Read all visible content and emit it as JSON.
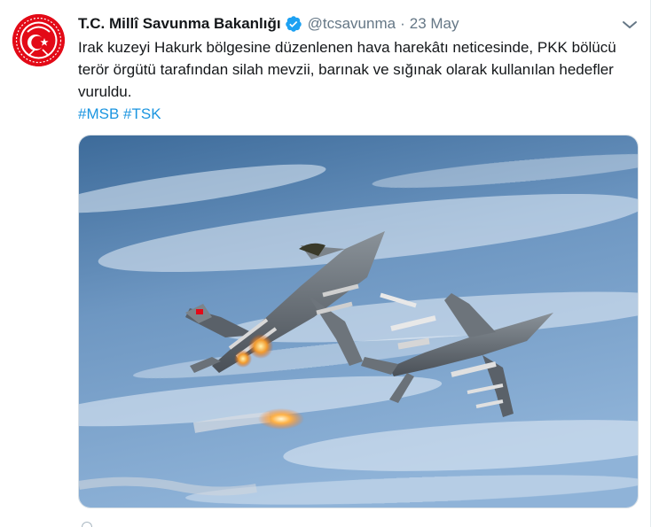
{
  "tweet": {
    "author_name": "T.C. Millî Savunma Bakanlığı",
    "author_handle": "@tcsavunma",
    "separator": "·",
    "timestamp": "23 May",
    "text": "Irak kuzeyi Hakurk bölgesine düzenlenen hava harekâtı neticesinde, PKK bölücü terör örgütü tarafından silah mevzii, barınak ve sığınak olarak kullanılan hedefler vuruldu.",
    "hashtags": [
      "#MSB",
      "#TSK"
    ]
  },
  "icons": {
    "verified": "verified-badge-icon",
    "caret": "chevron-down-icon"
  },
  "colors": {
    "link": "#1b95e0",
    "verified": "#1da1f2",
    "secondary_text": "#657786",
    "avatar_red": "#e30a17"
  }
}
